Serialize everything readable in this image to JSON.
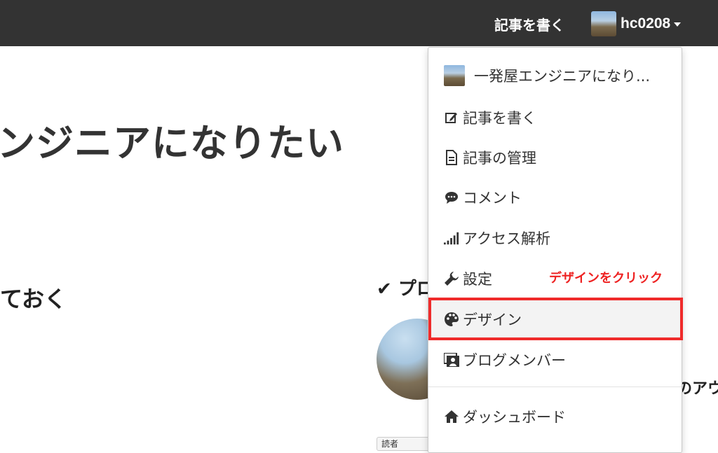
{
  "header": {
    "write_label": "記事を書く",
    "user_name": "hc0208"
  },
  "page": {
    "blog_title": "ンジニアになりたい",
    "post_title": "ておく",
    "profile_heading": "✔ プロ",
    "profile_snippet": "のアウ",
    "read_button": "読者"
  },
  "dropdown": {
    "items": [
      {
        "label": "一発屋エンジニアになり...",
        "icon": "blog-thumbnail"
      },
      {
        "label": "記事を書く",
        "icon": "edit-icon"
      },
      {
        "label": "記事の管理",
        "icon": "document-icon"
      },
      {
        "label": "コメント",
        "icon": "comment-icon"
      },
      {
        "label": "アクセス解析",
        "icon": "signal-icon"
      },
      {
        "label": "設定",
        "icon": "wrench-icon"
      },
      {
        "label": "デザイン",
        "icon": "palette-icon"
      },
      {
        "label": "ブログメンバー",
        "icon": "members-icon"
      },
      {
        "label": "ダッシュボード",
        "icon": "home-icon"
      }
    ]
  },
  "annotation": {
    "text": "デザインをクリック"
  },
  "colors": {
    "topbar": "#333333",
    "highlight": "#ef2b2b",
    "annotation": "#ee2222"
  }
}
